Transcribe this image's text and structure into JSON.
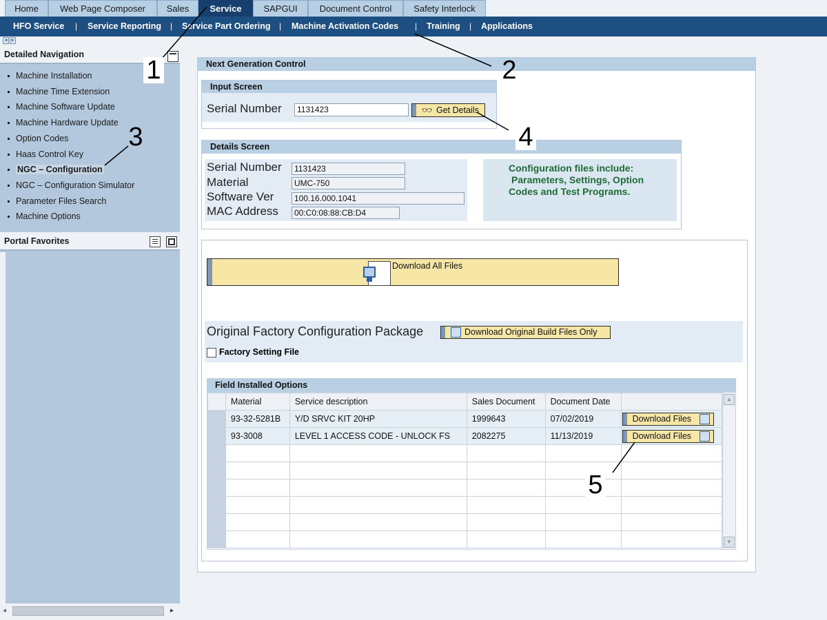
{
  "top_tabs": [
    "Home",
    "Web Page Composer",
    "Sales",
    "Service",
    "SAPGUI",
    "Document Control",
    "Safety Interlock"
  ],
  "active_tab": "Service",
  "sub_nav": [
    "HFO Service",
    "Service Reporting",
    "Service Part Ordering",
    "Machine Activation Codes",
    "Training",
    "Applications"
  ],
  "left_nav": {
    "detailed_title": "Detailed Navigation",
    "items": [
      "Machine Installation",
      "Machine Time Extension",
      "Machine Software Update",
      "Machine Hardware Update",
      "Option Codes",
      "Haas Control Key",
      "NGC – Configuration",
      "NGC – Configuration Simulator",
      "Parameter Files Search",
      "Machine Options"
    ],
    "selected": "NGC – Configuration",
    "favorites_title": "Portal Favorites"
  },
  "main": {
    "title": "Next Generation Control",
    "input_screen": {
      "title": "Input Screen",
      "serial_label": "Serial Number",
      "serial_value": "1131423",
      "get_details_label": "Get Details"
    },
    "details_screen": {
      "title": "Details Screen",
      "serial_label": "Serial Number",
      "serial_value": "1131423",
      "material_label": "Material",
      "material_value": "UMC-750",
      "software_label": "Software Ver",
      "software_value": "100.16.000.1041",
      "mac_label": "MAC Address",
      "mac_value": "00:C0:08:88:CB:D4",
      "info_line1": "Configuration files include:",
      "info_line2": "Parameters, Settings, Option",
      "info_line3": "Codes and Test Programs."
    },
    "download_all_label": "Download All Files",
    "original_package_label": "Original Factory Configuration Package",
    "download_original_label": "Download Original Build Files Only",
    "factory_setting_label": "Factory Setting File",
    "field_options": {
      "title": "Field Installed Options",
      "columns": [
        "Material",
        "Service description",
        "Sales Document",
        "Document Date"
      ],
      "rows": [
        {
          "material": "93-32-5281B",
          "description": "Y/D SRVC KIT 20HP",
          "sales_doc": "1999643",
          "date": "07/02/2019",
          "action": "Download Files"
        },
        {
          "material": "93-3008",
          "description": "LEVEL 1 ACCESS CODE - UNLOCK FS",
          "sales_doc": "2082275",
          "date": "11/13/2019",
          "action": "Download Files"
        }
      ]
    }
  },
  "annotations": [
    "1",
    "2",
    "3",
    "4",
    "5"
  ],
  "colors": {
    "tab_active": "#163f6e",
    "subnav": "#1d4f83",
    "left_pane": "#b3c8dd",
    "button_yellow": "#f7e7a7",
    "info_green": "#1f6b35"
  }
}
